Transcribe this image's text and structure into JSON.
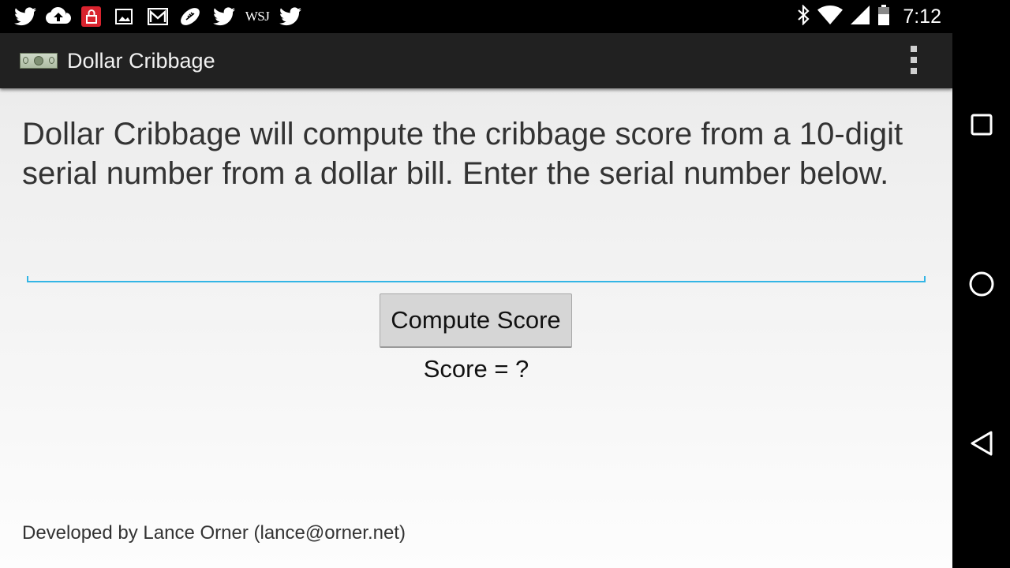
{
  "status_bar": {
    "notifications": [
      {
        "icon": "twitter-icon"
      },
      {
        "icon": "cloud-upload-icon"
      },
      {
        "icon": "lock-app-icon"
      },
      {
        "icon": "image-icon"
      },
      {
        "icon": "gmail-icon"
      },
      {
        "icon": "football-icon"
      },
      {
        "icon": "twitter-icon"
      },
      {
        "icon": "wsj-icon",
        "text": "WSJ"
      },
      {
        "icon": "twitter-icon"
      }
    ],
    "system_icons": [
      "bluetooth-icon",
      "wifi-icon",
      "cell-signal-icon",
      "battery-icon"
    ],
    "time": "7:12"
  },
  "action_bar": {
    "app_icon": "dollar-bill-icon",
    "title": "Dollar Cribbage",
    "overflow_icon": "overflow-menu-icon"
  },
  "main": {
    "intro_text": "Dollar Cribbage will compute the cribbage score from a 10-digit serial number from a dollar bill. Enter the serial number below.",
    "serial_input": {
      "value": "",
      "placeholder": ""
    },
    "compute_button_label": "Compute Score",
    "score_text": "Score = ?",
    "footer_text": "Developed by Lance Orner (lance@orner.net)"
  },
  "nav_bar": {
    "buttons": [
      "recents-icon",
      "home-icon",
      "back-icon"
    ]
  },
  "colors": {
    "accent": "#33b5e5",
    "action_bar_bg": "#212121",
    "button_bg": "#d6d6d6",
    "lock_icon_bg": "#d9232e"
  }
}
